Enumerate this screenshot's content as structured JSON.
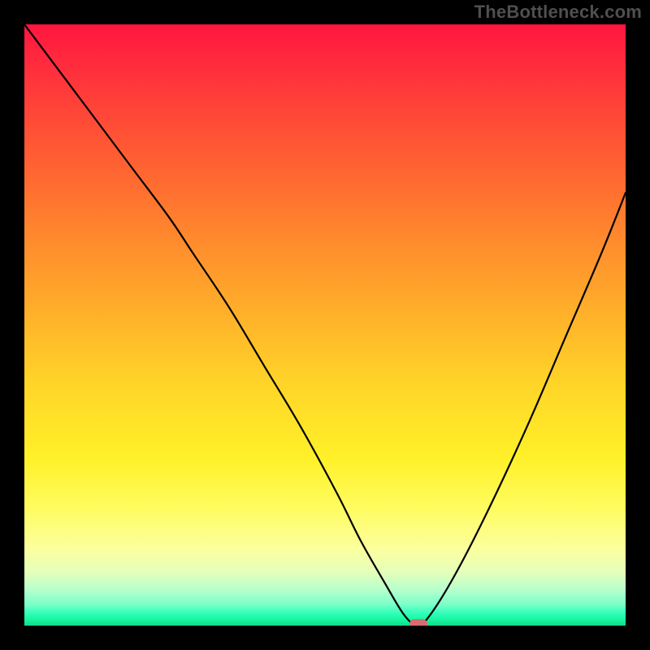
{
  "watermark": "TheBottleneck.com",
  "colors": {
    "frame": "#000000",
    "watermark": "#4f4f4f",
    "curve": "#000000",
    "marker": "#d96a6f"
  },
  "chart_data": {
    "type": "line",
    "title": "",
    "xlabel": "",
    "ylabel": "",
    "xlim": [
      0,
      100
    ],
    "ylim": [
      0,
      100
    ],
    "grid": false,
    "series": [
      {
        "name": "bottleneck-curve",
        "x": [
          0,
          6,
          12,
          18,
          24,
          28,
          34,
          40,
          46,
          52,
          56,
          60,
          63,
          65,
          66,
          69,
          73,
          78,
          84,
          90,
          96,
          100
        ],
        "values": [
          100,
          92,
          84,
          76,
          68,
          62,
          53,
          43,
          33,
          22,
          14,
          7,
          2,
          0,
          0,
          4,
          11,
          21,
          34,
          48,
          62,
          72
        ]
      }
    ],
    "marker": {
      "x": 65.5,
      "y": 0
    },
    "background_gradient": {
      "stops": [
        {
          "pct": 0,
          "color": "#ff153f"
        },
        {
          "pct": 6,
          "color": "#ff2a3d"
        },
        {
          "pct": 14,
          "color": "#ff4438"
        },
        {
          "pct": 26,
          "color": "#ff6a30"
        },
        {
          "pct": 38,
          "color": "#ff912c"
        },
        {
          "pct": 50,
          "color": "#ffb62a"
        },
        {
          "pct": 60,
          "color": "#ffd528"
        },
        {
          "pct": 72,
          "color": "#fff028"
        },
        {
          "pct": 80,
          "color": "#fffc5c"
        },
        {
          "pct": 87,
          "color": "#fcff9c"
        },
        {
          "pct": 91,
          "color": "#e6ffba"
        },
        {
          "pct": 94,
          "color": "#b7ffcc"
        },
        {
          "pct": 96.5,
          "color": "#7affc9"
        },
        {
          "pct": 98,
          "color": "#2effb8"
        },
        {
          "pct": 99,
          "color": "#18f59e"
        },
        {
          "pct": 100,
          "color": "#0fdc8c"
        }
      ]
    }
  }
}
